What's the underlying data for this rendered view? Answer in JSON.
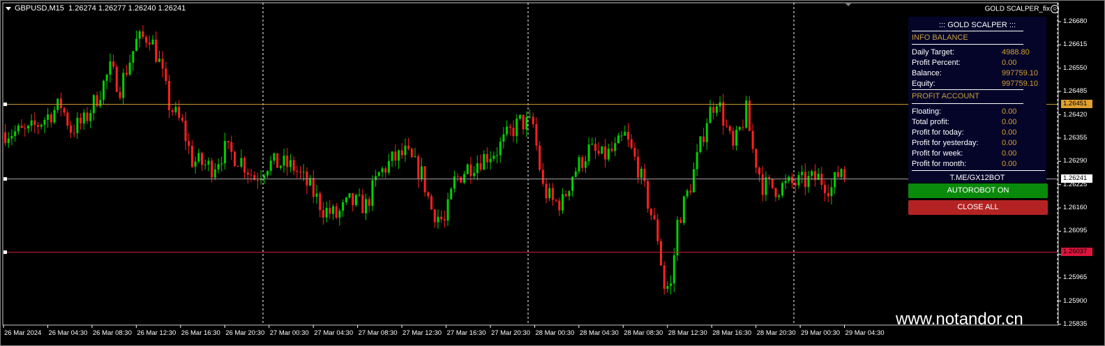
{
  "header": {
    "symbol": "GBPUSD,M15",
    "ohlc": "1.26274 1.26277 1.26240 1.26241",
    "ea_name": "GOLD SCALPER_fix"
  },
  "panel": {
    "title": "::: GOLD SCALPER :::",
    "info_section": "INFO BALANCE",
    "info_rows": [
      {
        "label": "Daily Target:",
        "value": "4988.80"
      },
      {
        "label": "Profit Percent:",
        "value": "0.00"
      },
      {
        "label": "Balance:",
        "value": "997759.10"
      },
      {
        "label": "Equity:",
        "value": "997759.10"
      }
    ],
    "profit_section": "PROFIT ACCOUNT",
    "profit_rows": [
      {
        "label": "Floating:",
        "value": "0.00"
      },
      {
        "label": "Total profit:",
        "value": "0.00"
      },
      {
        "label": "Profit for today:",
        "value": "0.00"
      },
      {
        "label": "Profit for yesterday:",
        "value": "0.00"
      },
      {
        "label": "Profit for week:",
        "value": "0.00"
      },
      {
        "label": "Profit for month:",
        "value": "0.00"
      }
    ],
    "link": "T.ME/GX12BOT",
    "autorobot_button": "AUTOROBOT ON",
    "close_all_button": "CLOSE ALL"
  },
  "watermark": "www.notandor.cn",
  "colors": {
    "bull": "#00d000",
    "bear": "#ff2020",
    "line_orange": "#c89632",
    "line_gray": "#a0a0a0",
    "line_red": "#c81e3c"
  },
  "chart_data": {
    "type": "candlestick",
    "symbol": "GBPUSD",
    "timeframe": "M15",
    "ylim": [
      1.25835,
      1.2668
    ],
    "y_ticks": [
      "1.26680",
      "1.26615",
      "1.26550",
      "1.26485",
      "1.26420",
      "1.26355",
      "1.26290",
      "1.26225",
      "1.26160",
      "1.26095",
      "1.26030",
      "1.25965",
      "1.25900",
      "1.25835"
    ],
    "x_ticks": [
      "26 Mar 2024",
      "26 Mar 04:30",
      "26 Mar 08:30",
      "26 Mar 12:30",
      "26 Mar 16:30",
      "26 Mar 20:30",
      "27 Mar 00:30",
      "27 Mar 04:30",
      "27 Mar 08:30",
      "27 Mar 12:30",
      "27 Mar 16:30",
      "27 Mar 20:30",
      "28 Mar 00:30",
      "28 Mar 04:30",
      "28 Mar 08:30",
      "28 Mar 12:30",
      "28 Mar 16:30",
      "28 Mar 20:30",
      "29 Mar 00:30",
      "29 Mar 04:30"
    ],
    "candle_count": 257,
    "close_path": [
      [
        0,
        1.26371
      ],
      [
        7,
        1.26371
      ],
      [
        12,
        1.2641
      ],
      [
        17,
        1.26448
      ],
      [
        20,
        1.2638
      ],
      [
        24,
        1.264
      ],
      [
        29,
        1.26487
      ],
      [
        32,
        1.26546
      ],
      [
        35,
        1.26497
      ],
      [
        40,
        1.26624
      ],
      [
        44,
        1.26643
      ],
      [
        47,
        1.26565
      ],
      [
        50,
        1.26448
      ],
      [
        54,
        1.2639
      ],
      [
        57,
        1.26293
      ],
      [
        63,
        1.26273
      ],
      [
        67,
        1.26322
      ],
      [
        72,
        1.26293
      ],
      [
        76,
        1.26244
      ],
      [
        80,
        1.26283
      ],
      [
        84,
        1.26283
      ],
      [
        88,
        1.26273
      ],
      [
        93,
        1.26215
      ],
      [
        97,
        1.26157
      ],
      [
        101,
        1.26137
      ],
      [
        105,
        1.26176
      ],
      [
        110,
        1.26166
      ],
      [
        114,
        1.26254
      ],
      [
        118,
        1.26293
      ],
      [
        122,
        1.26312
      ],
      [
        127,
        1.26254
      ],
      [
        130,
        1.26157
      ],
      [
        134,
        1.26118
      ],
      [
        137,
        1.26234
      ],
      [
        141,
        1.26273
      ],
      [
        146,
        1.26302
      ],
      [
        150,
        1.26322
      ],
      [
        154,
        1.26371
      ],
      [
        157,
        1.264
      ],
      [
        161,
        1.2639
      ],
      [
        164,
        1.26215
      ],
      [
        167,
        1.26176
      ],
      [
        170,
        1.26176
      ],
      [
        173,
        1.26254
      ],
      [
        178,
        1.26322
      ],
      [
        182,
        1.26302
      ],
      [
        186,
        1.26322
      ],
      [
        189,
        1.26361
      ],
      [
        193,
        1.26273
      ],
      [
        196,
        1.26176
      ],
      [
        199,
        1.26079
      ],
      [
        201,
        1.25942
      ],
      [
        203,
        1.25942
      ],
      [
        205,
        1.26118
      ],
      [
        209,
        1.26225
      ],
      [
        212,
        1.26332
      ],
      [
        214,
        1.2641
      ],
      [
        217,
        1.26468
      ],
      [
        219,
        1.2641
      ],
      [
        222,
        1.26322
      ],
      [
        226,
        1.2643
      ],
      [
        228,
        1.26322
      ],
      [
        231,
        1.26225
      ],
      [
        235,
        1.26215
      ],
      [
        239,
        1.26225
      ],
      [
        244,
        1.26234
      ],
      [
        248,
        1.26244
      ],
      [
        252,
        1.26215
      ],
      [
        255,
        1.26274
      ],
      [
        256,
        1.26241
      ]
    ],
    "day_separators": [
      "27 Mar",
      "28 Mar",
      "29 Mar"
    ],
    "horizontal_lines": [
      {
        "price": "1.26451",
        "color": "orange"
      },
      {
        "price": "1.26241",
        "color": "gray"
      },
      {
        "price": "1.26037",
        "color": "red"
      }
    ]
  }
}
